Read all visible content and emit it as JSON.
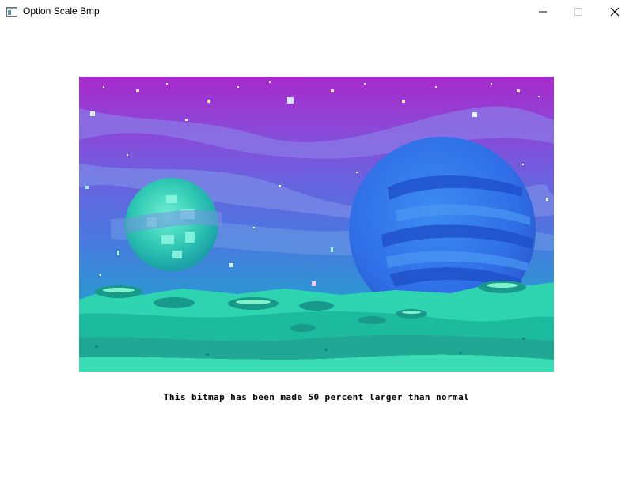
{
  "window": {
    "title": "Option Scale Bmp",
    "icon": "app-window-icon",
    "buttons": {
      "minimize": "minimize-icon",
      "maximize": "maximize-icon",
      "close": "close-icon"
    }
  },
  "bitmap": {
    "description_icon": "pixel-art-space-scene",
    "colors": {
      "sky_top": "#a32bc9",
      "sky_mid": "#6f63e0",
      "sky_low": "#2a8fd6",
      "planet_small": "#28c7b5",
      "planet_large": "#2f6ee6",
      "ground": "#2ed3b0"
    }
  },
  "caption": {
    "text": "This bitmap has been made 50 percent larger than normal"
  }
}
